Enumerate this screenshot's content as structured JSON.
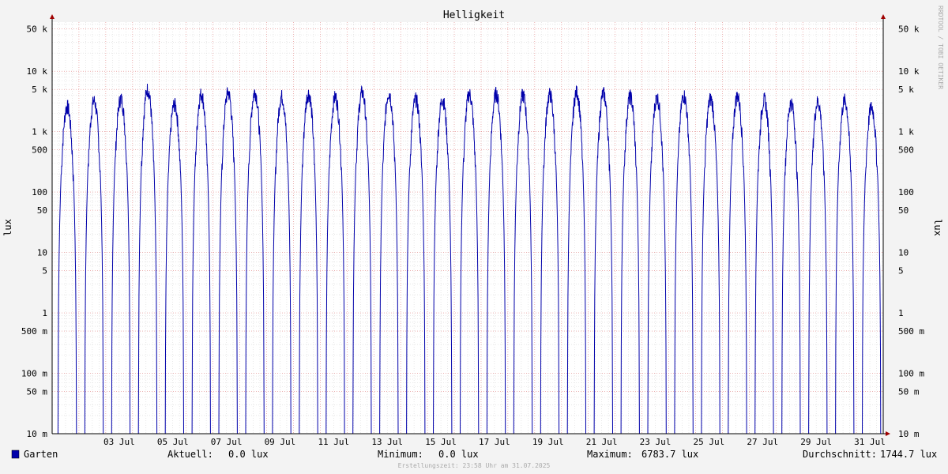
{
  "chart_data": {
    "type": "line",
    "title": "Helligkeit",
    "ylabel": "lux",
    "yscale": "log",
    "ylim": [
      10,
      60000
    ],
    "grid": true,
    "xlim_days": [
      "2025-07-01",
      "2025-08-01"
    ],
    "x_ticks": [
      "03 Jul",
      "05 Jul",
      "07 Jul",
      "09 Jul",
      "11 Jul",
      "13 Jul",
      "15 Jul",
      "17 Jul",
      "19 Jul",
      "21 Jul",
      "23 Jul",
      "25 Jul",
      "27 Jul",
      "29 Jul",
      "31 Jul"
    ],
    "y_ticks": [
      {
        "value": 10,
        "label": "10 m"
      },
      {
        "value": 50,
        "label": "50 m"
      },
      {
        "value": 100,
        "label": "100 m"
      },
      {
        "value": 500,
        "label": "500 m"
      },
      {
        "value": 1000,
        "label": "1"
      },
      {
        "value": 5000,
        "label": "5"
      },
      {
        "value": 10000,
        "label": "10"
      },
      {
        "value": 50000,
        "label": "50"
      },
      {
        "value": 100000,
        "label": "100"
      },
      {
        "value": 500000,
        "label": "500"
      },
      {
        "value": 1000000,
        "label": "1 k"
      },
      {
        "value": 5000000,
        "label": "5 k"
      },
      {
        "value": 10000000,
        "label": "10 k"
      },
      {
        "value": 50000000,
        "label": "50 k"
      }
    ],
    "series": [
      {
        "name": "Garten",
        "color": "#0000aa",
        "daily_peak_lux": [
          3400,
          4200,
          4600,
          6600,
          3700,
          5500,
          5800,
          5900,
          5000,
          5600,
          4900,
          5800,
          5700,
          4500,
          4500,
          5500,
          5600,
          5300,
          5400,
          5900,
          5600,
          5000,
          4800,
          5200,
          4600,
          5100,
          4400,
          3900,
          4100,
          4300,
          3300
        ],
        "night_min_lux": 0.0
      }
    ],
    "stats": {
      "current": "0.0 lux",
      "minimum": "0.0 lux",
      "maximum": "6783.7 lux",
      "average": "1744.7 lux"
    }
  },
  "legend": {
    "series_label": "Garten",
    "current_label": "Aktuell:",
    "current_value": "0.0 lux",
    "minimum_label": "Minimum:",
    "minimum_value": "0.0 lux",
    "maximum_label": "Maximum:",
    "maximum_value": "6783.7 lux",
    "average_label": "Durchschnitt:",
    "average_value": "1744.7 lux"
  },
  "footer": "Erstellungszeit: 23:58 Uhr am 31.07.2025",
  "watermark": "RRDTOOL / TOBI OETIKER",
  "colors": {
    "background": "#f3f3f3",
    "canvas": "#ffffff",
    "line": "#0000aa",
    "minor_grid": "#d8d8d8",
    "major_grid": "#e08080",
    "axis_arrow": "#a00000"
  }
}
